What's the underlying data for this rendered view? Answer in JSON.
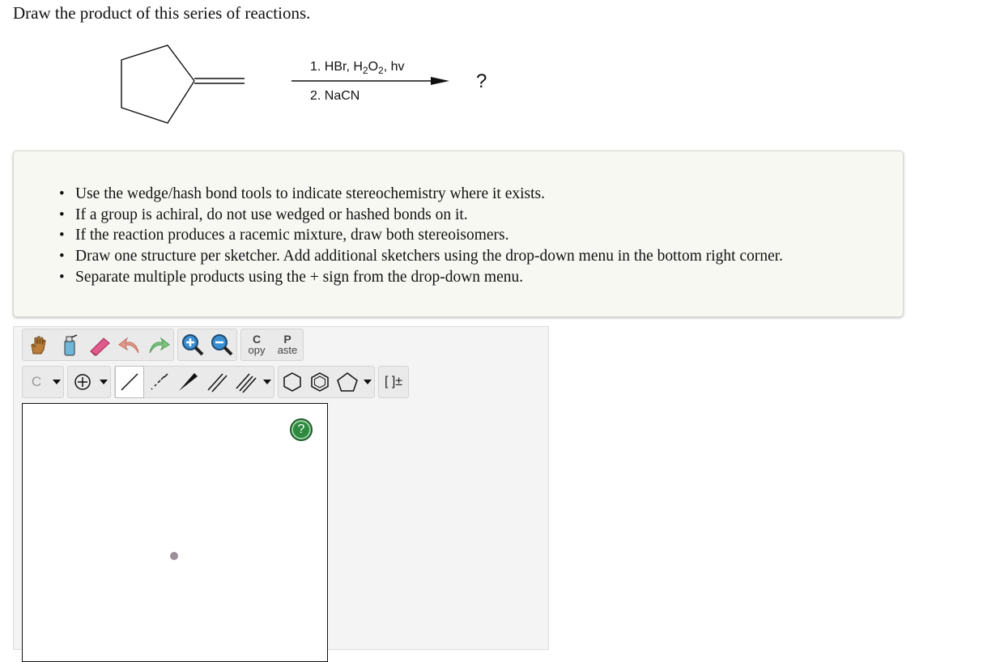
{
  "question": "Draw the product of this series of reactions.",
  "reaction": {
    "step1_prefix": "1. HBr, H",
    "step1_sub1": "2",
    "step1_mid": "O",
    "step1_sub2": "2",
    "step1_suffix": ", hv",
    "step2": "2. NaCN",
    "product": "?"
  },
  "instructions": [
    "Use the wedge/hash bond tools to indicate stereochemistry where it exists.",
    "If a group is achiral, do not use wedged or hashed bonds on it.",
    "If the reaction produces a racemic mixture, draw both stereoisomers.",
    "Draw one structure per sketcher. Add additional sketchers using the drop-down menu in the bottom right corner.",
    "Separate multiple products using the + sign from the drop-down menu."
  ],
  "bullet": "•",
  "toolbar": {
    "copy_big": "C",
    "copy_small": "opy",
    "paste_big": "P",
    "paste_small": "aste",
    "atom_label": "C",
    "bracket_label": "[ ]±"
  },
  "canvas": {
    "help": "?"
  },
  "icons": {
    "hand": "hand-icon",
    "clean": "clean-bottle-icon",
    "erase": "eraser-icon",
    "undo": "undo-icon",
    "redo": "redo-icon",
    "zoom_in": "zoom-in-icon",
    "zoom_out": "zoom-out-icon",
    "charge": "charge-plus-icon",
    "caret": "caret-down-icon",
    "single": "single-bond-icon",
    "hash": "hash-bond-icon",
    "wedge": "wedge-bond-icon",
    "double": "double-bond-icon",
    "triple": "triple-bond-icon",
    "cyclohexane": "cyclohexane-icon",
    "benzene": "benzene-icon",
    "cyclopentane": "cyclopentane-icon"
  },
  "colors": {
    "help_green": "#2d8a3e",
    "eraser_pink": "#e05b8c",
    "undo_salmon": "#e39a8a",
    "redo_green": "#7cc47f"
  }
}
